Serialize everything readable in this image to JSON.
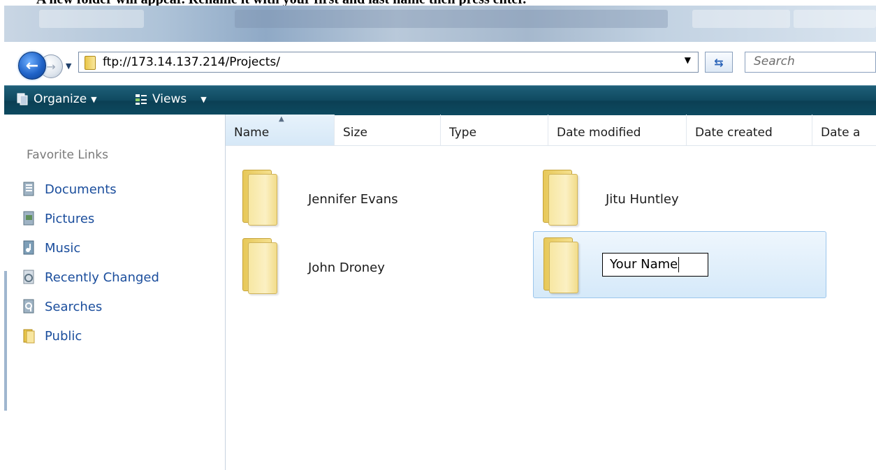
{
  "caption": "A new folder will appear. Rename it with your first and last name then press enter.",
  "address_bar": {
    "path": "ftp://173.14.137.214/Projects/",
    "search_placeholder": "Search"
  },
  "toolbar": {
    "organize_label": "Organize",
    "views_label": "Views"
  },
  "sidebar": {
    "heading": "Favorite Links",
    "items": [
      {
        "label": "Documents",
        "icon": "documents-icon"
      },
      {
        "label": "Pictures",
        "icon": "pictures-icon"
      },
      {
        "label": "Music",
        "icon": "music-icon"
      },
      {
        "label": "Recently Changed",
        "icon": "recently-changed-icon"
      },
      {
        "label": "Searches",
        "icon": "searches-icon"
      },
      {
        "label": "Public",
        "icon": "folder-icon"
      }
    ]
  },
  "columns": [
    "Name",
    "Size",
    "Type",
    "Date modified",
    "Date created",
    "Date a"
  ],
  "folders": [
    {
      "name": "Jennifer Evans"
    },
    {
      "name": "Jitu Huntley"
    },
    {
      "name": "John Droney"
    }
  ],
  "new_folder": {
    "rename_value": "Your Name"
  },
  "colors": {
    "toolbar": "#0f4a60",
    "link": "#1a4d9c",
    "selection": "#d5e9f9"
  }
}
